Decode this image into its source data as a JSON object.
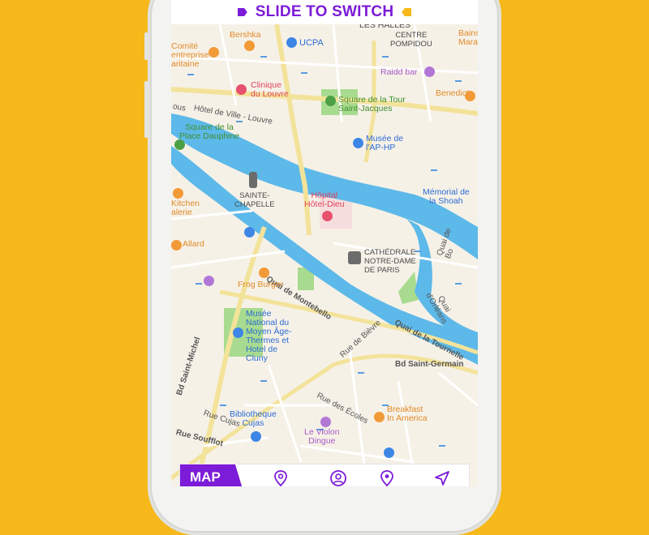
{
  "banner": {
    "title": "SLIDE TO SWITCH"
  },
  "colors": {
    "background": "#f6b81b",
    "accent": "#7c1bd8",
    "river": "#5db9e9",
    "park": "#a8db8f",
    "land": "#f6f1e7"
  },
  "map": {
    "labels": {
      "les_halles": "LES HALLES",
      "bershka": "Bershka",
      "ucpa": "UCPA",
      "centre_pompidou": "CENTRE\nPOMPIDOU",
      "bains_marais": "Bains\nMarais",
      "comite": "Comité\nentreprise\naritaine",
      "raidd_bar": "Raidd bar",
      "clinique": "Clinique\ndu Louvre",
      "square_tour": "Square de la Tour\nSaint-Jacques",
      "benedict": "Benedict",
      "hotel_de_ville": "Hôtel de Ville - Louvre",
      "hotel_de_ville_prefix": "ous",
      "square_dauphine": "Square de la\nPlace Dauphine",
      "musee_aphp": "Musée de\nl'AP-HP",
      "sainte_chapelle": "SAINTE-\nCHAPELLE",
      "hopital": "Hôpital\nHôtel-Dieu",
      "memorial": "Mémorial de\nla Shoah",
      "kitchen": "Kitchen\nalerie",
      "allard": "Allard",
      "cathedrale": "CATHÉDRALE\nNOTRE-DAME\nDE PARIS",
      "quai_montebello": "Quai de Montebello",
      "frog_burger": "Frog Burger",
      "quai_orleans": "Quai d'Orléans",
      "quai_bo": "Quai de Bo",
      "musee_moyen_age": "Musée\nNational du\nMoyen Âge-\nThermes et\nHotel de\nCluny",
      "quai_tournelle": "Quai de la Tournelle",
      "rue_bievre": "Rue de Bièvre",
      "bd_saint_michel": "Bd Saint-Michel",
      "bd_saint_germain": "Bd Saint-Germain",
      "rue_ecoles": "Rue des Écoles",
      "breakfast": "Breakfast\nIn America",
      "bibliotheque": "Bibliotheque\nCujas",
      "rue_cujas": "Rue Cujas",
      "le_violon": "Le Violon\nDingue",
      "rue_soufflot": "Rue Soufflot"
    }
  },
  "tabbar": {
    "map_label": "MAP",
    "icons": [
      "pin-icon",
      "profile-icon",
      "location-icon",
      "navigation-icon"
    ]
  }
}
